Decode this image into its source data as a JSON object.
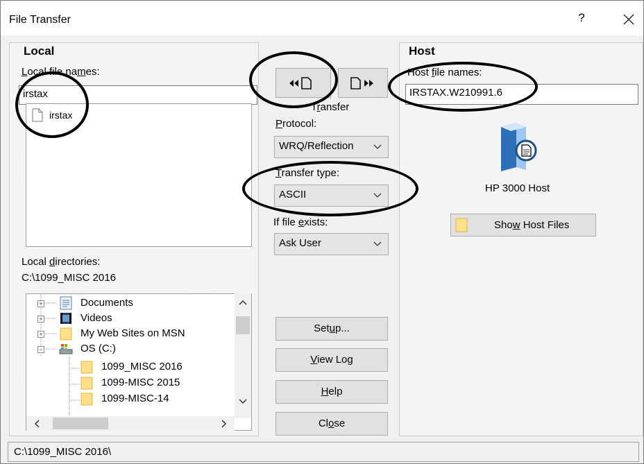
{
  "window": {
    "title": "File Transfer",
    "help_label": "?",
    "close_label": "✕"
  },
  "local": {
    "section_title": "Local",
    "file_names_label": "Local file names:",
    "file_name_value": "irstax",
    "files": [
      {
        "name": "irstax",
        "icon": "file-icon"
      }
    ],
    "directories_label": "Local directories:",
    "current_directory": "C:\\1099_MISC 2016",
    "tree": [
      {
        "label": "Documents",
        "icon": "documents-icon",
        "expander": "+"
      },
      {
        "label": "Videos",
        "icon": "videos-icon",
        "expander": "+"
      },
      {
        "label": "My Web Sites on MSN",
        "icon": "folder-icon",
        "expander": "+"
      },
      {
        "label": "OS (C:)",
        "icon": "drive-icon",
        "expander": "−"
      },
      {
        "label": "1099_MISC 2016",
        "icon": "folder-icon",
        "expander": ""
      },
      {
        "label": "1099-MISC 2015",
        "icon": "folder-icon",
        "expander": ""
      },
      {
        "label": "1099-MISC-14",
        "icon": "folder-icon",
        "expander": ""
      }
    ]
  },
  "transfer": {
    "label": "Transfer",
    "receive_icon": "receive-from-host-icon",
    "send_icon": "send-to-host-icon",
    "protocol_label": "Protocol:",
    "protocol_value": "WRQ/Reflection",
    "type_label": "Transfer type:",
    "type_value": "ASCII",
    "exists_label": "If file exists:",
    "exists_value": "Ask User"
  },
  "host": {
    "section_title": "Host",
    "file_names_label": "Host file names:",
    "file_name_value": "IRSTAX.W210991.6",
    "host_name": "HP 3000 Host",
    "show_files_label": "Show Host Files"
  },
  "buttons": {
    "setup": "Setup...",
    "view_log": "View Log",
    "help": "Help",
    "close": "Close"
  },
  "status_path": "C:\\1099_MISC 2016\\"
}
